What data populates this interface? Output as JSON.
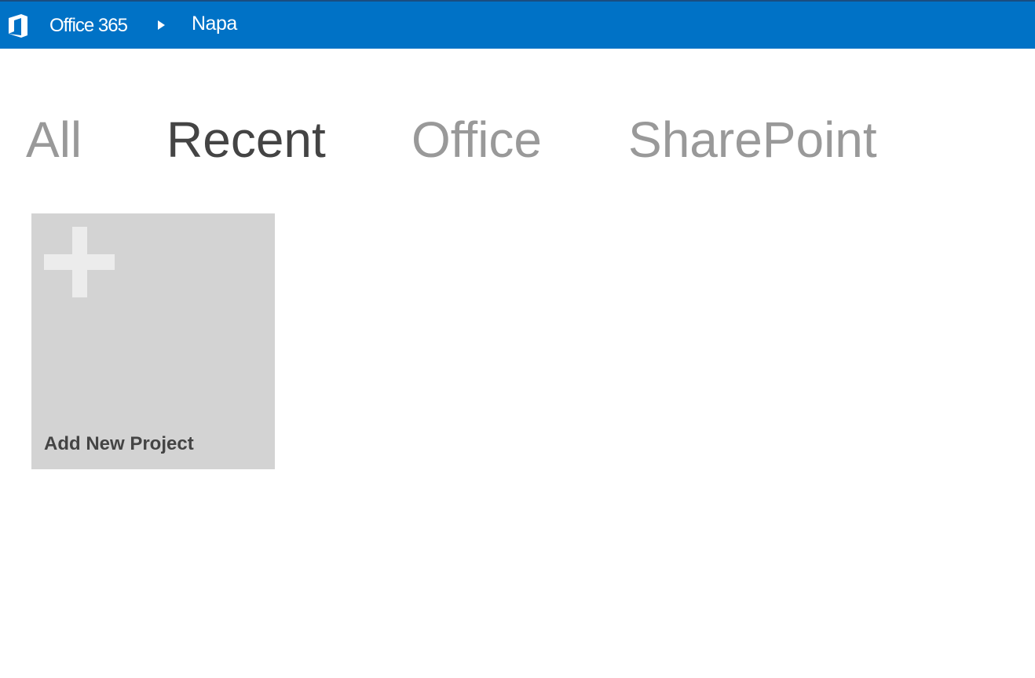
{
  "header": {
    "brand": "Office 365",
    "breadcrumb": "Napa",
    "logo_icon": "office-logo-icon",
    "separator_icon": "triangle-right-icon",
    "bar_color": "#0072c6"
  },
  "tabs": [
    {
      "label": "All",
      "active": false
    },
    {
      "label": "Recent",
      "active": true
    },
    {
      "label": "Office",
      "active": false
    },
    {
      "label": "SharePoint",
      "active": false
    }
  ],
  "tiles": {
    "add_project": {
      "label": "Add New Project",
      "icon": "plus-icon",
      "color": "#d3d3d3"
    }
  }
}
